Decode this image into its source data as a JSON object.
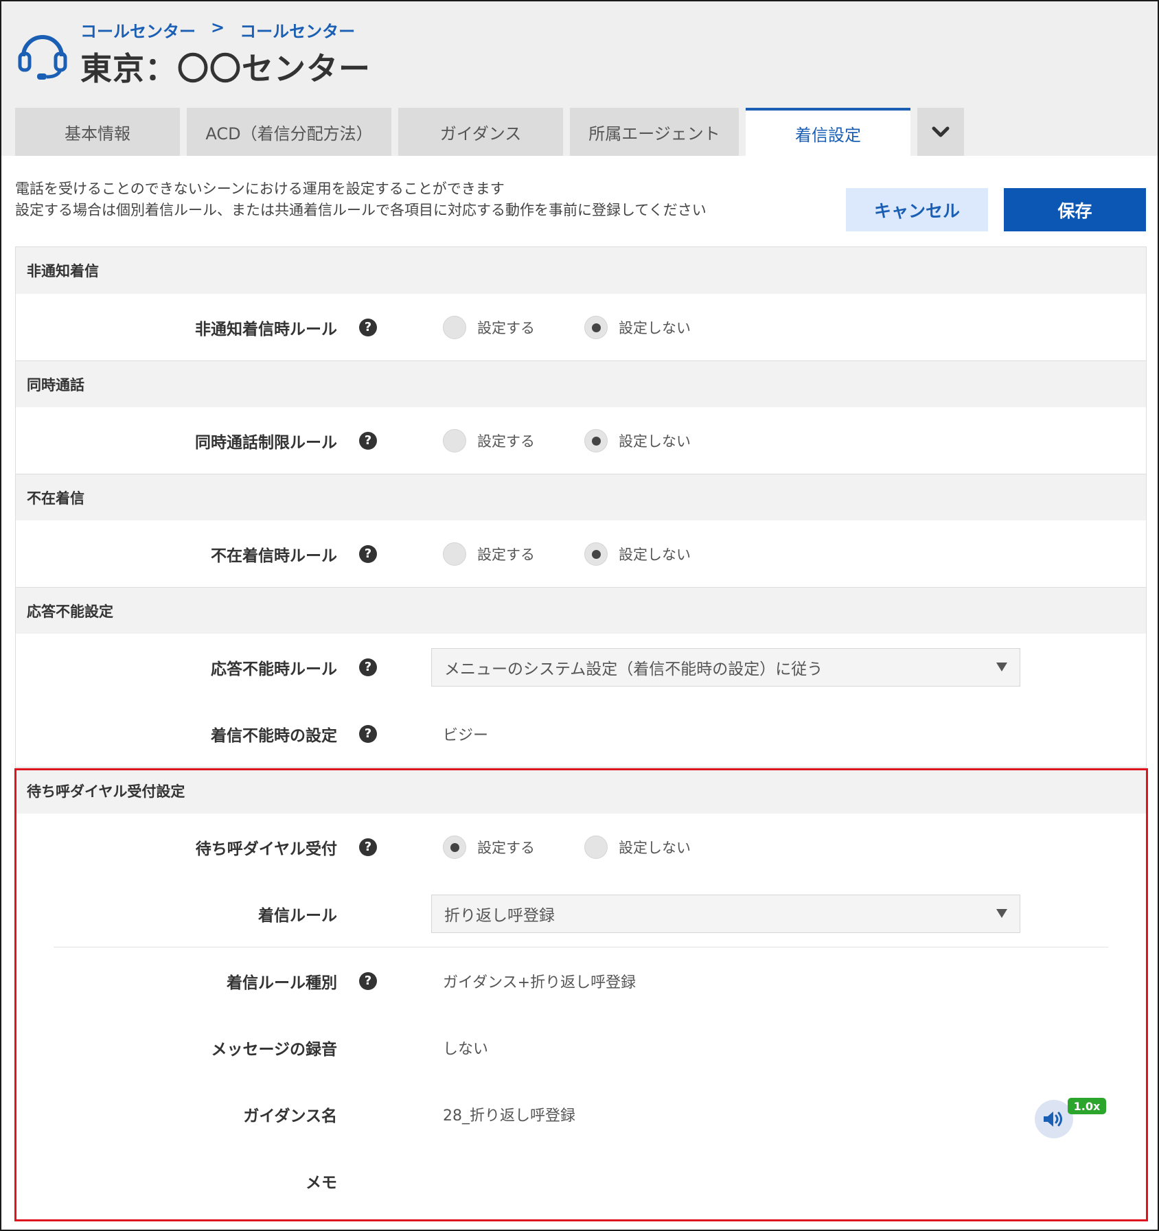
{
  "breadcrumb": {
    "items": [
      "コールセンター",
      "コールセンター"
    ],
    "separator": ">"
  },
  "header": {
    "title": "東京：〇〇センター"
  },
  "tabs": [
    {
      "label": "基本情報",
      "active": false
    },
    {
      "label": "ACD（着信分配方法）",
      "active": false
    },
    {
      "label": "ガイダンス",
      "active": false
    },
    {
      "label": "所属エージェント",
      "active": false
    },
    {
      "label": "着信設定",
      "active": true
    }
  ],
  "description": {
    "line1": "電話を受けることのできないシーンにおける運用を設定することができます",
    "line2": "設定する場合は個別着信ルール、または共通着信ルールで各項目に対応する動作を事前に登録してください"
  },
  "buttons": {
    "cancel": "キャンセル",
    "save": "保存"
  },
  "radio_labels": {
    "on": "設定する",
    "off": "設定しない"
  },
  "sections": {
    "anonymous": {
      "title": "非通知着信",
      "rule_label": "非通知着信時ルール",
      "selected": "設定しない"
    },
    "concurrent": {
      "title": "同時通話",
      "rule_label": "同時通話制限ルール",
      "selected": "設定しない"
    },
    "absent": {
      "title": "不在着信",
      "rule_label": "不在着信時ルール",
      "selected": "設定しない"
    },
    "unavailable": {
      "title": "応答不能設定",
      "rule_label": "応答不能時ルール",
      "rule_value": "メニューのシステム設定（着信不能時の設定）に従う",
      "setting_label": "着信不能時の設定",
      "setting_value": "ビジー"
    },
    "callback": {
      "title": "待ち呼ダイヤル受付設定",
      "accept_label": "待ち呼ダイヤル受付",
      "selected": "設定する",
      "rule_label": "着信ルール",
      "rule_value": "折り返し呼登録",
      "type_label": "着信ルール種別",
      "type_value": "ガイダンス+折り返し呼登録",
      "recording_label": "メッセージの録音",
      "recording_value": "しない",
      "guidance_label": "ガイダンス名",
      "guidance_value": "28_折り返し呼登録",
      "playback_speed": "1.0x",
      "memo_label": "メモ"
    }
  },
  "colors": {
    "accent": "#1a5fb4",
    "save": "#0d57b4",
    "highlight": "#e0141e",
    "badge": "#2ba52b"
  },
  "icons": {
    "header": "headset-icon",
    "help": "question-circle-icon",
    "more": "chevron-down-icon",
    "audio": "speaker-icon",
    "select": "triangle-down-icon"
  }
}
